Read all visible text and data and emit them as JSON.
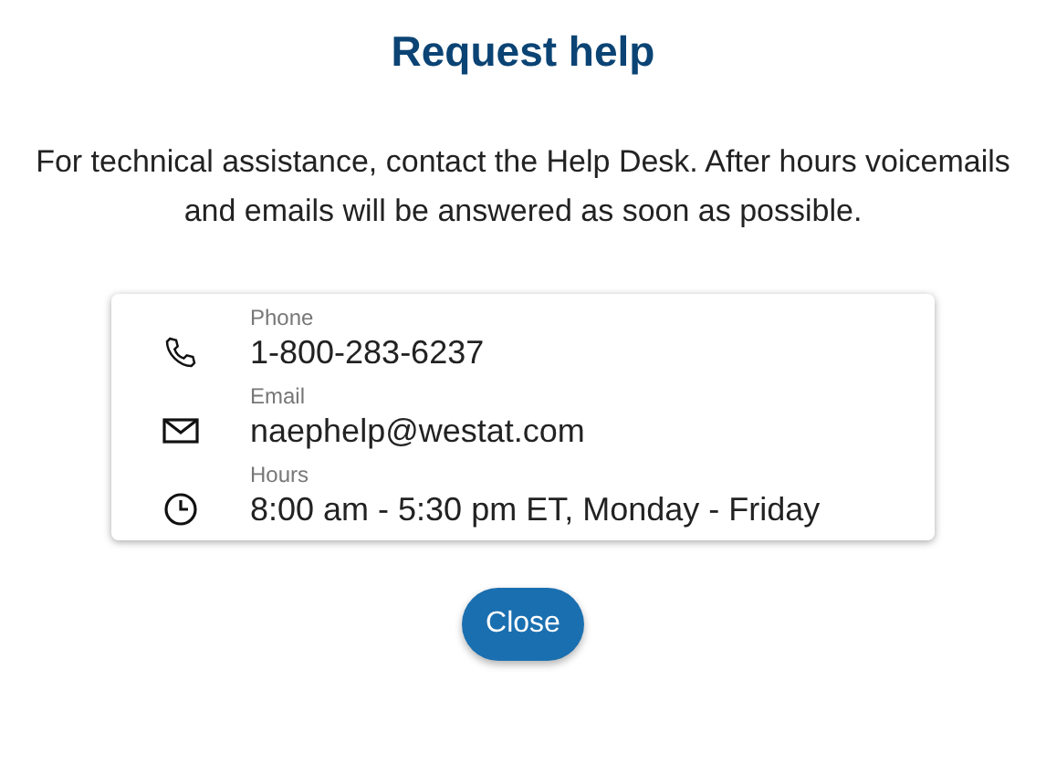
{
  "title": "Request help",
  "message": "For technical assistance, contact the Help Desk. After hours voicemails and emails will be answered as soon as possible.",
  "contacts": [
    {
      "kind": "phone",
      "label": "Phone",
      "value": "1-800-283-6237"
    },
    {
      "kind": "email",
      "label": "Email",
      "value": "naephelp@westat.com"
    },
    {
      "kind": "hours",
      "label": "Hours",
      "value": "8:00 am - 5:30 pm ET, Monday - Friday"
    }
  ],
  "buttons": [
    "Close"
  ]
}
